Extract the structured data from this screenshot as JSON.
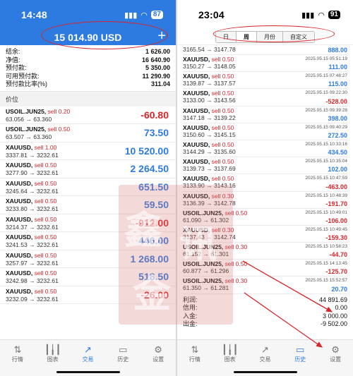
{
  "left": {
    "status": {
      "time": "14:48",
      "battery": "87"
    },
    "balance": "15 014.90 USD",
    "stats": [
      {
        "label": "结余:",
        "value": "1 626.00"
      },
      {
        "label": "净值:",
        "value": "16 640.90"
      },
      {
        "label": "预付款:",
        "value": "5 350.00"
      },
      {
        "label": "可用预付款:",
        "value": "11 290.90"
      },
      {
        "label": "预付款比率(%)",
        "value": "311.04"
      }
    ],
    "section_label": "价位",
    "positions": [
      {
        "symbol": "USOIL.JUN25,",
        "side": "sell 0.20",
        "prices": "63.056 → 63.360",
        "pl": "-60.80",
        "neg": true
      },
      {
        "symbol": "USOIL.JUN25,",
        "side": "sell 0.50",
        "prices": "63.507 → 63.360",
        "pl": "73.50",
        "neg": false
      },
      {
        "symbol": "XAUUSD,",
        "side": "sell 1.00",
        "prices": "3337.81 → 3232.61",
        "pl": "10 520.00",
        "neg": false
      },
      {
        "symbol": "XAUUSD,",
        "side": "sell 0.50",
        "prices": "3277.90 → 3232.61",
        "pl": "2 264.50",
        "neg": false
      },
      {
        "symbol": "XAUUSD,",
        "side": "sell 0.50",
        "prices": "3245.64 → 3232.61",
        "pl": "651.50",
        "neg": false
      },
      {
        "symbol": "XAUUSD,",
        "side": "sell 0.50",
        "prices": "3233.80 → 3232.61",
        "pl": "59.50",
        "neg": false
      },
      {
        "symbol": "XAUUSD,",
        "side": "sell 0.50",
        "prices": "3214.37 → 3232.61",
        "pl": "-912.00",
        "neg": true
      },
      {
        "symbol": "XAUUSD,",
        "side": "sell 0.50",
        "prices": "3241.53 → 3232.61",
        "pl": "446.00",
        "neg": false
      },
      {
        "symbol": "XAUUSD,",
        "side": "sell 0.50",
        "prices": "3257.97 → 3232.61",
        "pl": "1 268.00",
        "neg": false
      },
      {
        "symbol": "XAUUSD,",
        "side": "sell 0.50",
        "prices": "3242.98 → 3232.61",
        "pl": "518.50",
        "neg": false
      },
      {
        "symbol": "XAUUSD,",
        "side": "sell 0.50",
        "prices": "3232.09 → 3232.61",
        "pl": "-26.00",
        "neg": true
      }
    ],
    "tabs": [
      "行情",
      "图表",
      "交易",
      "历史",
      "设置"
    ]
  },
  "right": {
    "status": {
      "time": "23:04",
      "battery": "91"
    },
    "segments": [
      "日",
      "周",
      "月份",
      "自定义"
    ],
    "rows": [
      {
        "symbol": "",
        "side": "",
        "prices": "3165.54 → 3147.78",
        "date": "",
        "pl": "888.00",
        "neg": false
      },
      {
        "symbol": "XAUUSD,",
        "side": "sell 0.50",
        "prices": "3150.27 → 3148.05",
        "date": "2025.05.15 05:51:19",
        "pl": "111.00",
        "neg": false
      },
      {
        "symbol": "XAUUSD,",
        "side": "sell 0.50",
        "prices": "3139.87 → 3137.57",
        "date": "2025.05.15 07:48:27",
        "pl": "115.00",
        "neg": false
      },
      {
        "symbol": "XAUUSD,",
        "side": "sell 0.50",
        "prices": "3133.00 → 3143.56",
        "date": "2025.05.15 09:22:30",
        "pl": "-528.00",
        "neg": true
      },
      {
        "symbol": "XAUUSD,",
        "side": "sell 0.50",
        "prices": "3147.18 → 3139.22",
        "date": "2025.05.15 09:39:28",
        "pl": "398.00",
        "neg": false
      },
      {
        "symbol": "XAUUSD,",
        "side": "sell 0.50",
        "prices": "3150.60 → 3145.15",
        "date": "2025.05.15 09:40:29",
        "pl": "272.50",
        "neg": false
      },
      {
        "symbol": "XAUUSD,",
        "side": "sell 0.50",
        "prices": "3144.29 → 3135.60",
        "date": "2025.05.15 10:33:16",
        "pl": "434.50",
        "neg": false
      },
      {
        "symbol": "XAUUSD,",
        "side": "sell 0.50",
        "prices": "3139.73 → 3137.69",
        "date": "2025.05.15 10:35:04",
        "pl": "102.00",
        "neg": false
      },
      {
        "symbol": "XAUUSD,",
        "side": "sell 0.50",
        "prices": "3133.90 → 3143.16",
        "date": "2025.05.15 10:47:59",
        "pl": "-463.00",
        "neg": true
      },
      {
        "symbol": "XAUUSD,",
        "side": "sell 0.30",
        "prices": "3136.39 → 3142.78",
        "date": "2025.05.15 10:48:39",
        "pl": "-191.70",
        "neg": true
      },
      {
        "symbol": "USOIL.JUN25,",
        "side": "sell 0.50",
        "prices": "61.090 → 61.302",
        "date": "2025.05.15 10:49:01",
        "pl": "-106.00",
        "neg": true
      },
      {
        "symbol": "XAUUSD,",
        "side": "sell 0.30",
        "prices": "3137.43 → 3142.74",
        "date": "2025.05.15 10:49:45",
        "pl": "-159.30",
        "neg": true
      },
      {
        "symbol": "USOIL.JUN25,",
        "side": "sell 0.30",
        "prices": "61.152 → 61.301",
        "date": "2025.05.15 10:58:23",
        "pl": "-44.70",
        "neg": true
      },
      {
        "symbol": "USOIL.JUN25,",
        "side": "sell 0.50",
        "prices": "60.877 → 61.296",
        "date": "2025.05.15 14:13:45",
        "pl": "-125.70",
        "neg": true
      },
      {
        "symbol": "USOIL.JUN25,",
        "side": "sell 0.30",
        "prices": "61.350 → 61.281",
        "date": "2025.05.15 15:52:57",
        "pl": "20.70",
        "neg": false
      }
    ],
    "summary": [
      {
        "label": "利润:",
        "value": "44 891.69"
      },
      {
        "label": "信用:",
        "value": "0.00"
      },
      {
        "label": "入金:",
        "value": "3 000.00"
      },
      {
        "label": "出金:",
        "value": "-9 502.00"
      }
    ],
    "tabs": [
      "行情",
      "图表",
      "交易",
      "历史",
      "设置"
    ]
  },
  "colors": {
    "accent": "#2d7be0",
    "negative": "#d8252a",
    "annotation": "#d8252a"
  },
  "icons": [
    "wifi-icon",
    "signal-icon",
    "plus-icon",
    "quotes-icon",
    "chart-icon",
    "trade-icon",
    "history-icon",
    "settings-icon"
  ]
}
